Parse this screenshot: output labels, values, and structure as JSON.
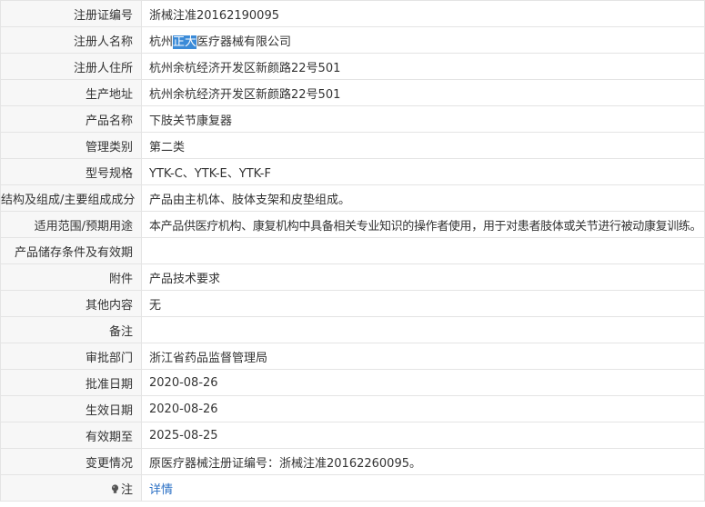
{
  "rows": [
    {
      "label": "注册证编号",
      "value": "浙械注准20162190095"
    },
    {
      "label": "注册人名称",
      "value_before": "杭州",
      "value_highlight": "正大",
      "value_after": "医疗器械有限公司"
    },
    {
      "label": "注册人住所",
      "value": "杭州余杭经济开发区新颜路22号501"
    },
    {
      "label": "生产地址",
      "value": "杭州余杭经济开发区新颜路22号501"
    },
    {
      "label": "产品名称",
      "value": "下肢关节康复器"
    },
    {
      "label": "管理类别",
      "value": "第二类"
    },
    {
      "label": "型号规格",
      "value": "YTK-C、YTK-E、YTK-F"
    },
    {
      "label": "结构及组成/主要组成成分",
      "value": "产品由主机体、肢体支架和皮垫组成。"
    },
    {
      "label": "适用范围/预期用途",
      "value": "本产品供医疗机构、康复机构中具备相关专业知识的操作者使用，用于对患者肢体或关节进行被动康复训练。"
    },
    {
      "label": "产品储存条件及有效期",
      "value": ""
    },
    {
      "label": "附件",
      "value": "产品技术要求"
    },
    {
      "label": "其他内容",
      "value": "无"
    },
    {
      "label": "备注",
      "value": ""
    },
    {
      "label": "审批部门",
      "value": "浙江省药品监督管理局"
    },
    {
      "label": "批准日期",
      "value": "2020-08-26"
    },
    {
      "label": "生效日期",
      "value": "2020-08-26"
    },
    {
      "label": "有效期至",
      "value": "2025-08-25"
    },
    {
      "label": "变更情况",
      "value": "原医疗器械注册证编号：浙械注准20162260095。"
    }
  ],
  "note": {
    "icon": "bulb-icon",
    "label": "注",
    "link": "详情"
  },
  "colors": {
    "label_bg": "#f7f7f7",
    "border": "#e4e4e4",
    "highlight_bg": "#3b8bd8",
    "link": "#2a6fc4"
  }
}
